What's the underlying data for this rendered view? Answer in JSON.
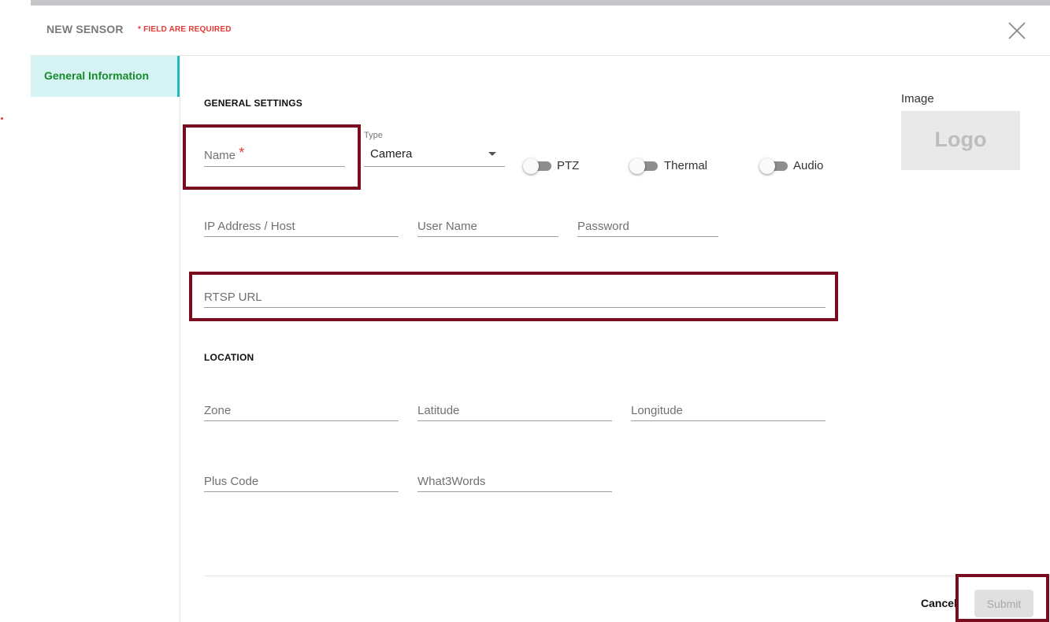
{
  "header": {
    "title": "NEW SENSOR",
    "required_note": "* FIELD ARE REQUIRED",
    "close_icon": "close-icon"
  },
  "sidebar": {
    "items": [
      {
        "label": "General Information",
        "active": true
      }
    ]
  },
  "general_settings": {
    "heading": "GENERAL SETTINGS",
    "name": {
      "label": "Name",
      "required_mark": "*",
      "value": ""
    },
    "type": {
      "label": "Type",
      "value": "Camera"
    },
    "toggles": [
      {
        "label": "PTZ",
        "on": false
      },
      {
        "label": "Thermal",
        "on": false
      },
      {
        "label": "Audio",
        "on": false
      }
    ],
    "ip_host": {
      "placeholder": "IP Address / Host",
      "value": ""
    },
    "user_name": {
      "placeholder": "User Name",
      "value": ""
    },
    "password": {
      "placeholder": "Password",
      "value": ""
    },
    "rtsp_url": {
      "placeholder": "RTSP URL",
      "value": ""
    }
  },
  "image": {
    "label": "Image",
    "placeholder_text": "Logo"
  },
  "location": {
    "heading": "LOCATION",
    "zone": {
      "placeholder": "Zone",
      "value": ""
    },
    "latitude": {
      "placeholder": "Latitude",
      "value": ""
    },
    "longitude": {
      "placeholder": "Longitude",
      "value": ""
    },
    "plus_code": {
      "placeholder": "Plus Code",
      "value": ""
    },
    "what3words": {
      "placeholder": "What3Words",
      "value": ""
    }
  },
  "footer": {
    "cancel_label": "Cancel",
    "submit_label": "Submit"
  },
  "colors": {
    "accent": "#29b6c3",
    "active_text": "#178a2a",
    "required": "#e53935",
    "highlight": "#7a0c1f"
  }
}
